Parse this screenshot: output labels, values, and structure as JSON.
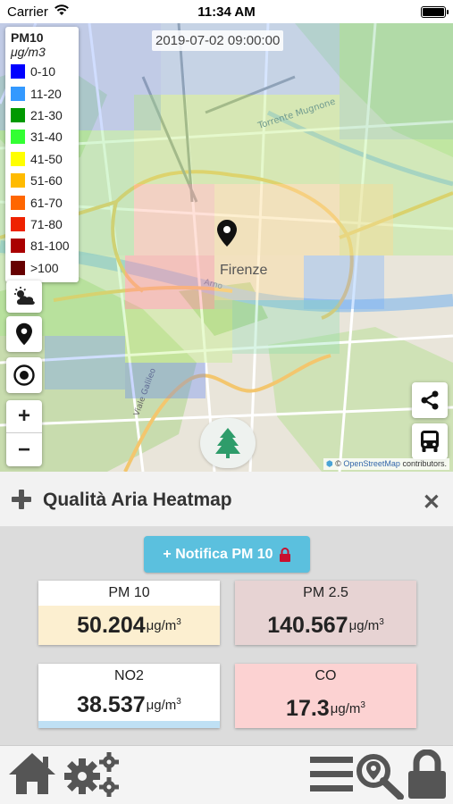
{
  "status_bar": {
    "carrier": "Carrier",
    "time": "11:34 AM"
  },
  "map": {
    "timestamp": "2019-07-02 09:00:00",
    "city_label": "Firenze",
    "attribution_prefix": "©",
    "attribution_link": "OpenStreetMap",
    "attribution_suffix": "contributors."
  },
  "legend": {
    "title": "PM10",
    "unit": "μg/m3",
    "items": [
      {
        "label": "0-10",
        "color": "#0000ff"
      },
      {
        "label": "11-20",
        "color": "#3399ff"
      },
      {
        "label": "21-30",
        "color": "#009900"
      },
      {
        "label": "31-40",
        "color": "#33ff33"
      },
      {
        "label": "41-50",
        "color": "#ffff00"
      },
      {
        "label": "51-60",
        "color": "#ffbb00"
      },
      {
        "label": "61-70",
        "color": "#ff6600"
      },
      {
        "label": "71-80",
        "color": "#ee2200"
      },
      {
        "label": "81-100",
        "color": "#aa0000"
      },
      {
        "label": ">100",
        "color": "#660000"
      }
    ]
  },
  "zoom": {
    "in": "+",
    "out": "−"
  },
  "panel": {
    "title": "Qualità Aria Heatmap",
    "close": "✕"
  },
  "notify_button": {
    "label": "+ Notifica PM 10"
  },
  "cards": [
    {
      "label": "PM 10",
      "value": "50.204",
      "unit": "μg/m",
      "exp": "3",
      "label_bg": "#ffffff",
      "value_bg": "#fcefd0"
    },
    {
      "label": "PM 2.5",
      "value": "140.567",
      "unit": "μg/m",
      "exp": "3",
      "label_bg": "#e7d3d3",
      "value_bg": "#e7d3d3"
    },
    {
      "label": "NO2",
      "value": "38.537",
      "unit": "μg/m",
      "exp": "3",
      "label_bg": "#ffffff",
      "value_bg": "#ffffff"
    },
    {
      "label": "CO",
      "value": "17.3",
      "unit": "μg/m",
      "exp": "3",
      "label_bg": "#fcd2d2",
      "value_bg": "#fcd2d2"
    }
  ],
  "colors": {
    "accent": "#5bc0de",
    "icon_gray": "#555555"
  }
}
